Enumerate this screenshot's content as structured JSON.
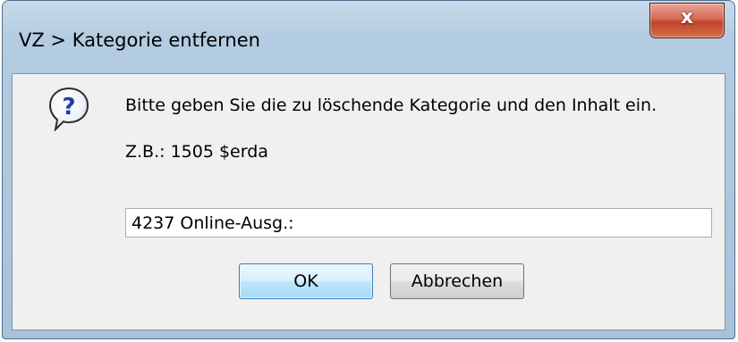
{
  "window": {
    "title": "VZ > Kategorie entfernen",
    "close_label": "x"
  },
  "dialog": {
    "icon": "question-icon",
    "message": "Bitte geben Sie die zu löschende Kategorie und den Inhalt ein.",
    "example": "Z.B.: 1505 $erda",
    "input_value": "4237 Online-Ausg.:"
  },
  "buttons": {
    "ok_label": "OK",
    "cancel_label": "Abbrechen"
  },
  "colors": {
    "titlebar": "#b4cce1",
    "close_button": "#c2432a",
    "client_background": "#f0f0f0",
    "default_button_border": "#3c7fb1"
  }
}
